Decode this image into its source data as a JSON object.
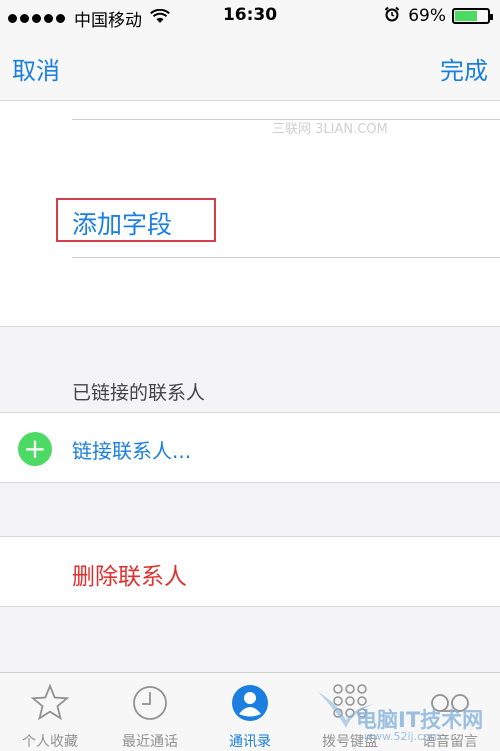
{
  "status_bar": {
    "carrier": "中国移动",
    "time": "16:30",
    "battery_percent": "69%",
    "battery_level": 0.69,
    "signal_bars": 5
  },
  "nav": {
    "cancel_label": "取消",
    "done_label": "完成"
  },
  "watermark_top": "三联网 3LIAN.COM",
  "add_field_label": "添加字段",
  "linked_section_header": "已链接的联系人",
  "link_contact_label": "链接联系人...",
  "delete_contact_label": "删除联系人",
  "tabs": [
    {
      "label": "个人收藏",
      "icon": "star-icon"
    },
    {
      "label": "最近通话",
      "icon": "clock-icon"
    },
    {
      "label": "通讯录",
      "icon": "contacts-icon",
      "active": true
    },
    {
      "label": "拨号键盘",
      "icon": "keypad-icon"
    },
    {
      "label": "语音留言",
      "icon": "voicemail-icon"
    }
  ],
  "watermark_bottom": {
    "title": "电脑IT技术网",
    "url": "www.52ij.com"
  },
  "colors": {
    "accent": "#1a7fe0",
    "destructive": "#e0312f",
    "add_green": "#4cd964",
    "highlight_red": "#d2404a"
  }
}
